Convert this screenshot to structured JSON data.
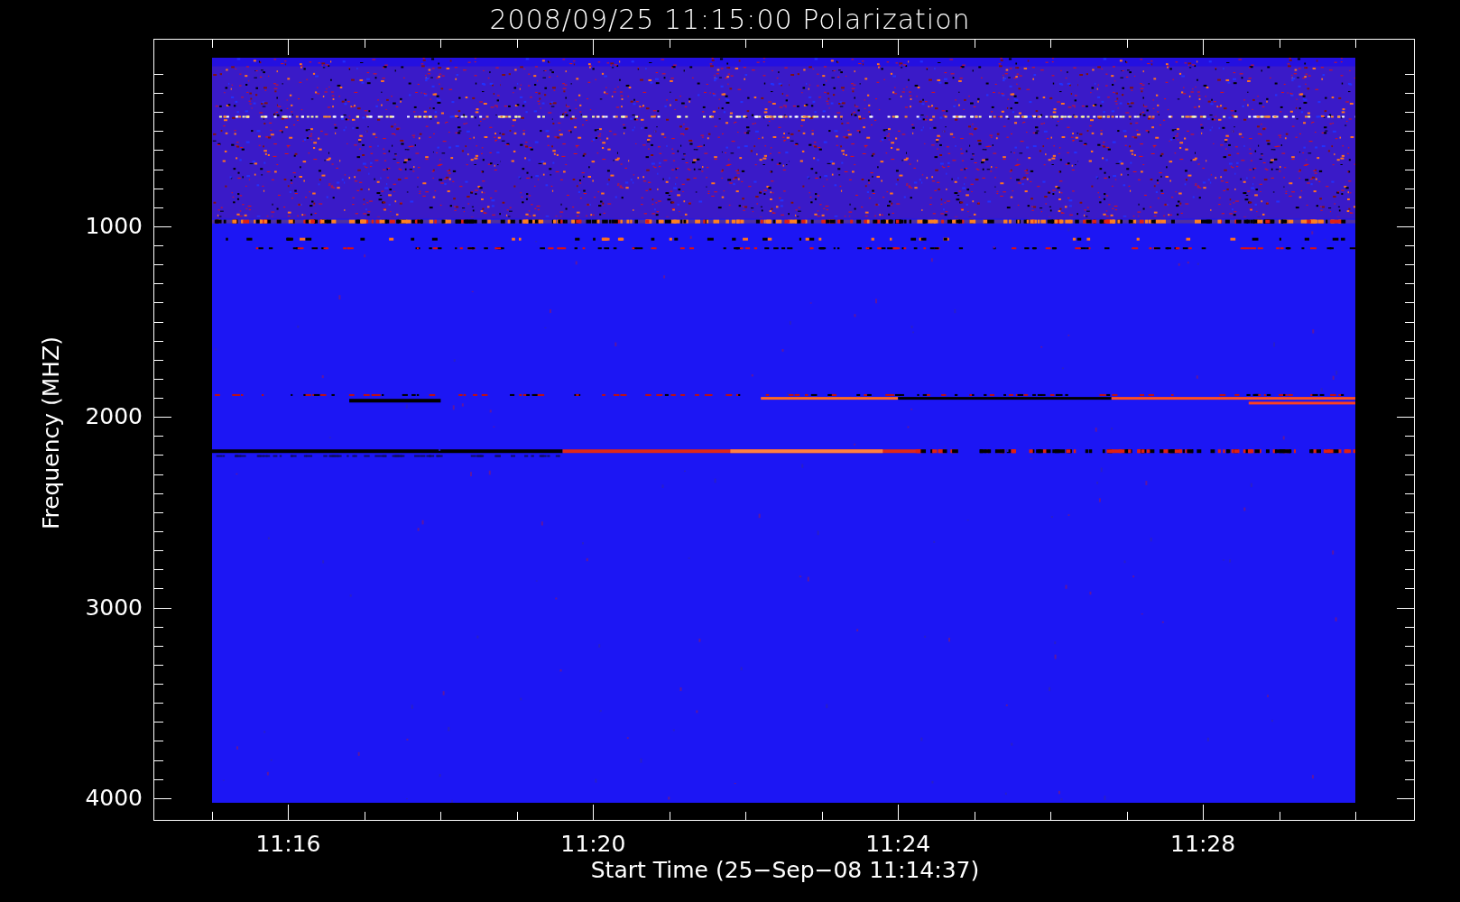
{
  "title": "2008/09/25 11:15:00 Polarization",
  "y_axis": {
    "label": "Frequency (MHZ)",
    "ticks": [
      "1000",
      "2000",
      "3000",
      "4000"
    ]
  },
  "x_axis": {
    "label": "Start Time (25−Sep−08 11:14:37)",
    "ticks": [
      "11:16",
      "11:20",
      "11:24",
      "11:28"
    ]
  }
}
